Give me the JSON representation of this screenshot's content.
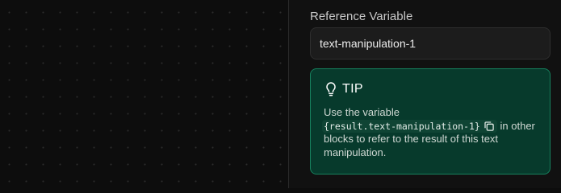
{
  "reference": {
    "label": "Reference Variable",
    "value": "text-manipulation-1"
  },
  "tip": {
    "icon": "lightbulb-icon",
    "title": "TIP",
    "line1": "Use the variable",
    "code": "{result.text-manipulation-1}",
    "copy_icon": "copy-icon",
    "after_code": "in",
    "rest": "other blocks to refer to the result of this text manipulation."
  },
  "colors": {
    "tip_background": "#073a2c",
    "tip_border": "#16805d",
    "panel_background": "#111111"
  }
}
